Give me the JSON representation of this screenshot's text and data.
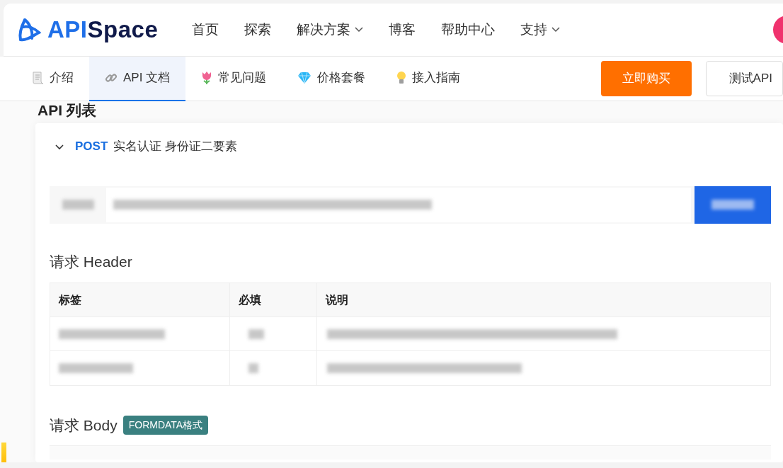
{
  "header": {
    "logo": {
      "part_1": "API",
      "part_2": "Space"
    },
    "nav": [
      {
        "label": "首页",
        "dropdown": false
      },
      {
        "label": "探索",
        "dropdown": false
      },
      {
        "label": "解决方案",
        "dropdown": true
      },
      {
        "label": "博客",
        "dropdown": false
      },
      {
        "label": "帮助中心",
        "dropdown": false
      },
      {
        "label": "支持",
        "dropdown": true
      }
    ]
  },
  "tabs": [
    {
      "label": "介绍",
      "selected": false
    },
    {
      "label": "API 文档",
      "selected": true
    },
    {
      "label": "常见问题",
      "selected": false
    },
    {
      "label": "价格套餐",
      "selected": false
    },
    {
      "label": "接入指南",
      "selected": false
    }
  ],
  "actions": [
    {
      "label": "立即购买",
      "kind": "primary"
    },
    {
      "label": "测试API",
      "kind": "outline"
    }
  ],
  "section_title": "API 列表",
  "endpoint": {
    "expanded": true,
    "method": "POST",
    "name": "实名认证 身份证二要素",
    "url_bar": {
      "kind": "blurred"
    },
    "header_title": "请求 Header",
    "header_table": {
      "columns": [
        "标签",
        "必填",
        "说明"
      ],
      "rows": [
        {
          "kind": "blurred"
        },
        {
          "kind": "blurred"
        }
      ]
    },
    "body_title": "请求 Body",
    "body_badge": "FORMDATA格式"
  }
}
